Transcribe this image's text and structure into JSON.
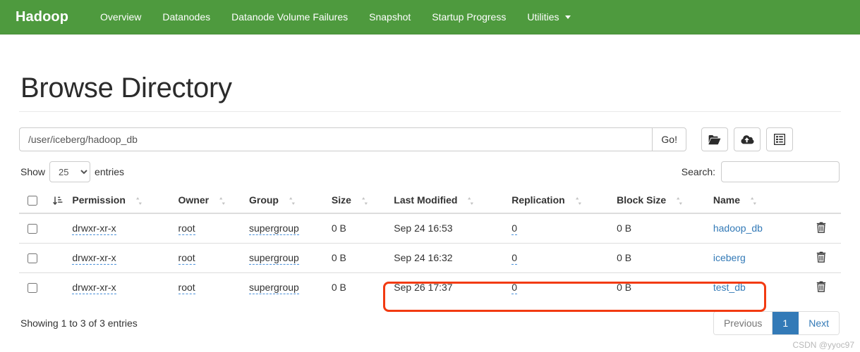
{
  "navbar": {
    "brand": "Hadoop",
    "items": [
      {
        "label": "Overview",
        "dropdown": false
      },
      {
        "label": "Datanodes",
        "dropdown": false
      },
      {
        "label": "Datanode Volume Failures",
        "dropdown": false
      },
      {
        "label": "Snapshot",
        "dropdown": false
      },
      {
        "label": "Startup Progress",
        "dropdown": false
      },
      {
        "label": "Utilities",
        "dropdown": true
      }
    ],
    "background_color": "#4e9a3e"
  },
  "page": {
    "title": "Browse Directory"
  },
  "path_bar": {
    "value": "/user/iceberg/hadoop_db",
    "placeholder": "",
    "go_label": "Go!",
    "buttons": [
      {
        "name": "create-directory-button",
        "icon": "folder-icon"
      },
      {
        "name": "upload-file-button",
        "icon": "cloud-upload-icon"
      },
      {
        "name": "cut-paste-button",
        "icon": "clipboard-list-icon"
      }
    ]
  },
  "controls": {
    "show_label": "Show",
    "entries_label": "entries",
    "page_length_selected": "25",
    "page_length_options": [
      "25",
      "50",
      "100"
    ],
    "search_label": "Search:",
    "search_value": "",
    "search_placeholder": ""
  },
  "table": {
    "columns": [
      {
        "key": "check",
        "label": ""
      },
      {
        "key": "sorticon",
        "label": ""
      },
      {
        "key": "permission",
        "label": "Permission"
      },
      {
        "key": "owner",
        "label": "Owner"
      },
      {
        "key": "group",
        "label": "Group"
      },
      {
        "key": "size",
        "label": "Size"
      },
      {
        "key": "last_modified",
        "label": "Last Modified"
      },
      {
        "key": "replication",
        "label": "Replication"
      },
      {
        "key": "block_size",
        "label": "Block Size"
      },
      {
        "key": "name",
        "label": "Name"
      },
      {
        "key": "actions",
        "label": ""
      }
    ],
    "rows": [
      {
        "permission": "drwxr-xr-x",
        "owner": "root",
        "group": "supergroup",
        "size": "0 B",
        "last_modified": "Sep 24 16:53",
        "replication": "0",
        "block_size": "0 B",
        "name": "hadoop_db"
      },
      {
        "permission": "drwxr-xr-x",
        "owner": "root",
        "group": "supergroup",
        "size": "0 B",
        "last_modified": "Sep 24 16:32",
        "replication": "0",
        "block_size": "0 B",
        "name": "iceberg"
      },
      {
        "permission": "drwxr-xr-x",
        "owner": "root",
        "group": "supergroup",
        "size": "0 B",
        "last_modified": "Sep 26 17:37",
        "replication": "0",
        "block_size": "0 B",
        "name": "test_db"
      }
    ]
  },
  "footer": {
    "info": "Showing 1 to 3 of 3 entries",
    "previous_label": "Previous",
    "page_label": "1",
    "next_label": "Next"
  },
  "annotation": {
    "color": "#f23a11"
  },
  "watermark": {
    "text": "CSDN @yyoc97"
  }
}
